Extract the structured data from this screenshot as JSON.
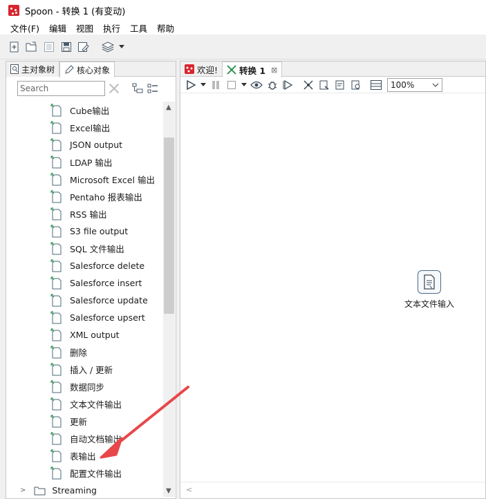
{
  "window": {
    "title": "Spoon - 转换 1 (有变动)"
  },
  "menu": [
    "文件(F)",
    "编辑",
    "视图",
    "执行",
    "工具",
    "帮助"
  ],
  "left_panel": {
    "tabs": [
      {
        "label": "主对象树"
      },
      {
        "label": "核心对象"
      }
    ],
    "search": {
      "placeholder": "Search",
      "value": ""
    },
    "items": [
      {
        "label": "Cube输出",
        "icon": "cube-output-icon"
      },
      {
        "label": "Excel输出",
        "icon": "excel-output-icon"
      },
      {
        "label": "JSON output",
        "icon": "json-output-icon"
      },
      {
        "label": "LDAP 输出",
        "icon": "ldap-output-icon"
      },
      {
        "label": "Microsoft Excel 输出",
        "icon": "ms-excel-output-icon"
      },
      {
        "label": "Pentaho 报表输出",
        "icon": "report-output-icon"
      },
      {
        "label": "RSS 输出",
        "icon": "rss-output-icon"
      },
      {
        "label": "S3 file output",
        "icon": "s3-output-icon"
      },
      {
        "label": "SQL 文件输出",
        "icon": "sql-output-icon"
      },
      {
        "label": "Salesforce delete",
        "icon": "salesforce-delete-icon"
      },
      {
        "label": "Salesforce insert",
        "icon": "salesforce-insert-icon"
      },
      {
        "label": "Salesforce update",
        "icon": "salesforce-update-icon"
      },
      {
        "label": "Salesforce upsert",
        "icon": "salesforce-upsert-icon"
      },
      {
        "label": "XML output",
        "icon": "xml-output-icon"
      },
      {
        "label": "删除",
        "icon": "delete-icon"
      },
      {
        "label": "插入 / 更新",
        "icon": "insert-update-icon"
      },
      {
        "label": "数据同步",
        "icon": "sync-icon"
      },
      {
        "label": "文本文件输出",
        "icon": "text-output-icon"
      },
      {
        "label": "更新",
        "icon": "refresh-icon"
      },
      {
        "label": "自动文档输出",
        "icon": "autodoc-icon"
      },
      {
        "label": "表输出",
        "icon": "table-output-icon"
      },
      {
        "label": "配置文件输出",
        "icon": "config-output-icon"
      }
    ],
    "streaming": "Streaming"
  },
  "right_panel": {
    "tabs": [
      {
        "label": "欢迎!"
      },
      {
        "label": "转换 1"
      }
    ],
    "zoom": "100%",
    "canvas_node": {
      "label": "文本文件输入"
    }
  },
  "colors": {
    "accent_red": "#d8262e",
    "annotation_arrow": "#e8474a"
  }
}
